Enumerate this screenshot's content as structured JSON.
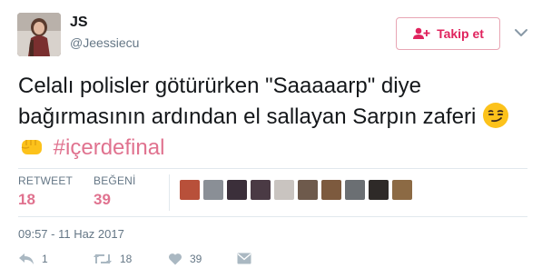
{
  "user": {
    "display_name": "JS",
    "handle": "@Jeessiecu"
  },
  "follow_button": {
    "label": "Takip et"
  },
  "tweet": {
    "text_main": "Celalı polisler götürürken \"Saaaaarp\" diye bağırmasının ardından el sallayan Sarpın zaferi",
    "hashtag": "#içerdefinal",
    "emojis": [
      "smirking-face-icon",
      "fisted-hand-icon"
    ]
  },
  "stats": {
    "retweet_label": "RETWEET",
    "retweet_count": "18",
    "like_label": "BEĞENİ",
    "like_count": "39"
  },
  "timestamp": "09:57 - 11 Haz 2017",
  "actions": {
    "reply_count": "1",
    "retweet_count": "18",
    "like_count": "39"
  },
  "colors": {
    "accent": "#e0245e",
    "hashtag": "#e0728f",
    "muted": "#657786"
  }
}
